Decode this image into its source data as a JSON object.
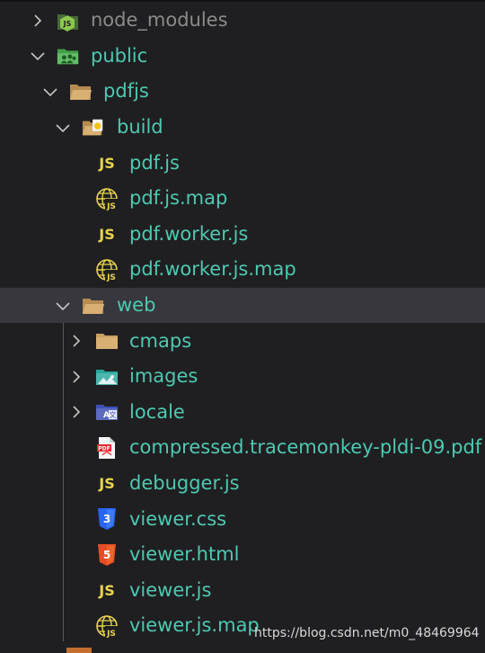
{
  "explorer": {
    "items": [
      {
        "label": "node_modules",
        "icon": "nodejs-folder-icon",
        "expanded": false
      },
      {
        "label": "public",
        "icon": "public-folder-icon",
        "expanded": true
      },
      {
        "label": "pdfjs",
        "icon": "folder-open-icon",
        "expanded": true
      },
      {
        "label": "build",
        "icon": "build-folder-icon",
        "expanded": true
      },
      {
        "label": "pdf.js",
        "icon": "js-file-icon"
      },
      {
        "label": "pdf.js.map",
        "icon": "js-map-file-icon"
      },
      {
        "label": "pdf.worker.js",
        "icon": "js-file-icon"
      },
      {
        "label": "pdf.worker.js.map",
        "icon": "js-map-file-icon"
      },
      {
        "label": "web",
        "icon": "folder-open-icon",
        "expanded": true,
        "selected": true
      },
      {
        "label": "cmaps",
        "icon": "folder-icon",
        "expanded": false
      },
      {
        "label": "images",
        "icon": "images-folder-icon",
        "expanded": false
      },
      {
        "label": "locale",
        "icon": "locale-folder-icon",
        "expanded": false
      },
      {
        "label": "compressed.tracemonkey-pldi-09.pdf",
        "icon": "pdf-file-icon"
      },
      {
        "label": "debugger.js",
        "icon": "js-file-icon"
      },
      {
        "label": "viewer.css",
        "icon": "css-file-icon"
      },
      {
        "label": "viewer.html",
        "icon": "html-file-icon"
      },
      {
        "label": "viewer.js",
        "icon": "js-file-icon"
      },
      {
        "label": "viewer.js.map",
        "icon": "js-map-file-icon"
      }
    ],
    "js_icon_text": "JS",
    "map_icon_text": "JS",
    "css_icon_text": "3",
    "html_icon_text": "5",
    "pdf_icon_text": "PDF"
  },
  "watermark": "https://blog.csdn.net/m0_48469964",
  "colors": {
    "background": "#1f1f21",
    "label": "#4ec9b0",
    "selected_row": "#37373d",
    "js_yellow": "#e8d44d",
    "folder_tan": "#d0a66a",
    "css_blue": "#2965f1",
    "html_orange": "#e44d26",
    "pdf_red": "#e12e2e"
  }
}
